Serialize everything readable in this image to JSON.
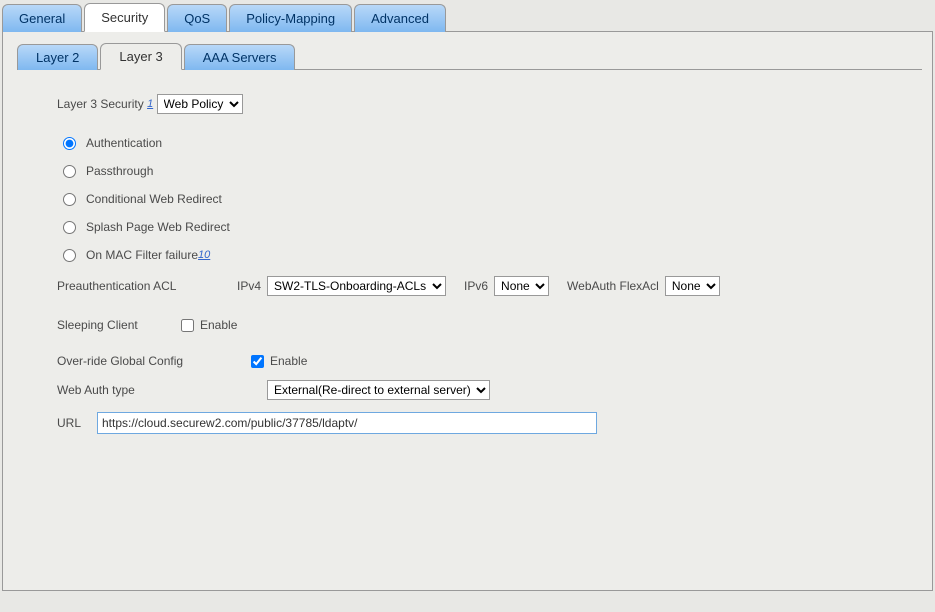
{
  "outer_tabs": {
    "general": "General",
    "security": "Security",
    "qos": "QoS",
    "policy_mapping": "Policy-Mapping",
    "advanced": "Advanced"
  },
  "inner_tabs": {
    "layer2": "Layer 2",
    "layer3": "Layer 3",
    "aaa": "AAA Servers"
  },
  "layer3": {
    "security_label": "Layer 3 Security",
    "security_footnote": "1",
    "security_select": "Web Policy",
    "radios": {
      "authentication": "Authentication",
      "passthrough": "Passthrough",
      "conditional": "Conditional Web Redirect",
      "splash": "Splash Page Web Redirect",
      "mac_filter": "On MAC Filter failure",
      "mac_filter_footnote": "10"
    },
    "preauth": {
      "label": "Preauthentication ACL",
      "ipv4_label": "IPv4",
      "ipv4_value": "SW2-TLS-Onboarding-ACLs",
      "ipv6_label": "IPv6",
      "ipv6_value": "None",
      "flexacl_label": "WebAuth FlexAcl",
      "flexacl_value": "None"
    },
    "sleeping_label": "Sleeping Client",
    "sleeping_enable": "Enable",
    "override_label": "Over-ride Global Config",
    "override_enable": "Enable",
    "webauth_type_label": "Web Auth type",
    "webauth_type_value": "External(Re-direct to external server)",
    "url_label": "URL",
    "url_value": "https://cloud.securew2.com/public/37785/ldaptv/"
  }
}
